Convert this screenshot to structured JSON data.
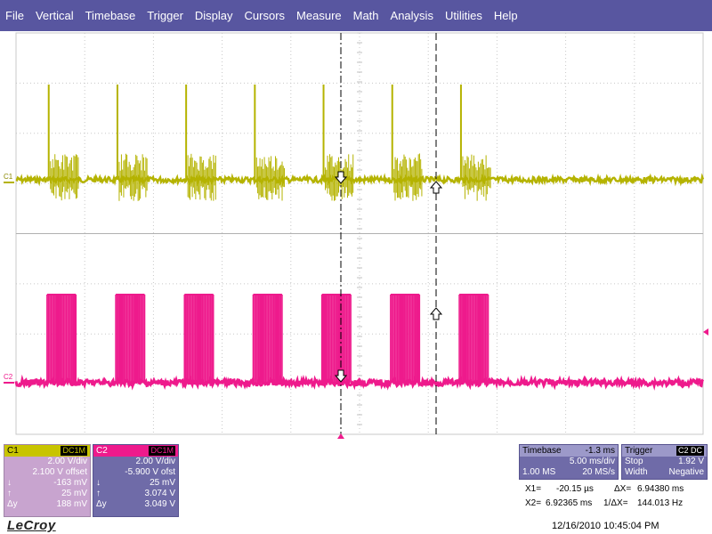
{
  "menu": [
    "File",
    "Vertical",
    "Timebase",
    "Trigger",
    "Display",
    "Cursors",
    "Measure",
    "Math",
    "Analysis",
    "Utilities",
    "Help"
  ],
  "colors": {
    "c1": "#b5b300",
    "c2": "#ee1a8c",
    "menubar": "#5856a0"
  },
  "trace_labels": {
    "c1": "C1",
    "c2": "C2"
  },
  "c1_panel": {
    "title": "C1",
    "coupling": "DC1M",
    "vdiv": "2.00 V/div",
    "offset": "2.100 V offset",
    "rows": [
      {
        "sym": "↓",
        "val": "-163 mV"
      },
      {
        "sym": "↑",
        "val": "25 mV"
      },
      {
        "sym": "Δy",
        "val": "188 mV"
      }
    ]
  },
  "c2_panel": {
    "title": "C2",
    "coupling": "DC1M",
    "vdiv": "2.00 V/div",
    "offset": "-5.900 V ofst",
    "rows": [
      {
        "sym": "↓",
        "val": "25 mV"
      },
      {
        "sym": "↑",
        "val": "3.074 V"
      },
      {
        "sym": "Δy",
        "val": "3.049 V"
      }
    ]
  },
  "timebase": {
    "title": "Timebase",
    "delay": "-1.3 ms",
    "tdiv": "5.00 ms/div",
    "samples": "1.00 MS",
    "rate": "20 MS/s"
  },
  "trigger": {
    "title": "Trigger",
    "source": "C2",
    "coupling": "DC",
    "mode": "Stop",
    "level": "1.92 V",
    "type": "Width",
    "slope": "Negative"
  },
  "cursors": {
    "x1_label": "X1=",
    "x1": "-20.15 µs",
    "dx_label": "ΔX=",
    "dx": "6.94380 ms",
    "x2_label": "X2=",
    "x2": "6.92365 ms",
    "inv_dx_label": "1/ΔX=",
    "inv_dx": "144.013 Hz"
  },
  "brand": "LeCroy",
  "datetime": "12/16/2010 10:45:04 PM",
  "signals": {
    "c1_bursts_div": [
      0.45,
      1.45,
      2.45,
      3.45,
      4.45,
      5.45,
      6.45
    ],
    "c2_bursts_div": [
      0.4,
      1.4,
      2.4,
      3.4,
      4.4,
      5.4,
      6.4
    ],
    "burst_width_div": 0.42
  }
}
